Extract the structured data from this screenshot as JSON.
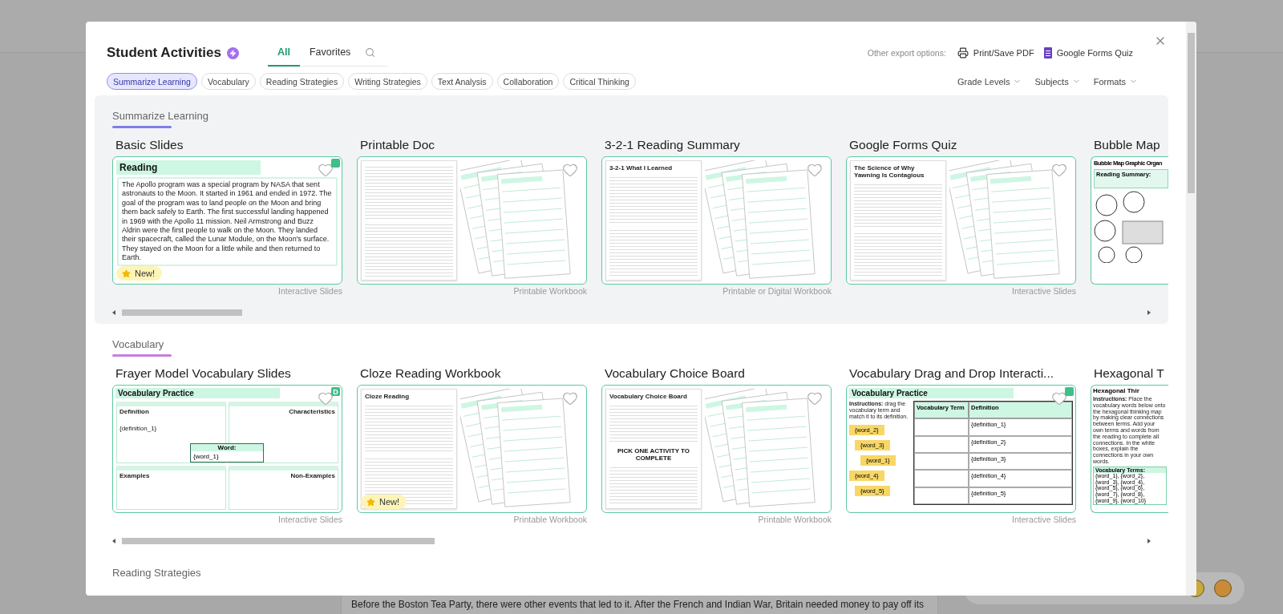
{
  "background": {
    "article_text": "Before the Boston Tea Party, there were other events that led to it. After the French and Indian War, Britain needed money to pay off its"
  },
  "modal": {
    "title": "Student Activities",
    "tabs": [
      {
        "label": "All",
        "selected": true
      },
      {
        "label": "Favorites",
        "selected": false
      }
    ],
    "export": {
      "label": "Other export options:",
      "options": [
        {
          "kind": "printer",
          "label": "Print/Save PDF"
        },
        {
          "kind": "form",
          "label": "Google Forms Quiz"
        }
      ]
    },
    "chips": [
      {
        "label": "Summarize Learning",
        "selected": true
      },
      {
        "label": "Vocabulary",
        "selected": false
      },
      {
        "label": "Reading Strategies",
        "selected": false
      },
      {
        "label": "Writing Strategies",
        "selected": false
      },
      {
        "label": "Text Analysis",
        "selected": false
      },
      {
        "label": "Collaboration",
        "selected": false
      },
      {
        "label": "Critical Thinking",
        "selected": false
      }
    ],
    "filters": [
      "Grade Levels",
      "Subjects",
      "Formats"
    ],
    "sections": [
      {
        "title": "Summarize Learning",
        "color": "#7f7fe6",
        "shaded": true,
        "cards": [
          {
            "title": "Basic Slides",
            "favorite": false,
            "corner": {
              "kind": "slides"
            },
            "badge": "New!",
            "format": "Interactive Slides",
            "thumbnail": {
              "kind": "slide",
              "heading": "Reading",
              "body": "The Apollo program was a special program by NASA that sent astronauts to the Moon. It started in 1961 and ended in 1972. The goal of the program was to land people on the Moon and bring them back safely to Earth. The first successful landing happened in 1969 with the Apollo 11 mission. Neil Armstrong and Buzz Aldrin were the first people to walk on the Moon. They landed their spacecraft, called the Lunar Module, on the Moon's surface. They stayed on the Moon for a little while and then returned to Earth."
            }
          },
          {
            "title": "Printable Doc",
            "favorite": false,
            "format": "Printable Workbook",
            "thumbnail": {
              "kind": "pages"
            }
          },
          {
            "title": "3-2-1 Reading Summary",
            "favorite": false,
            "format": "Printable or Digital Workbook",
            "thumbnail": {
              "kind": "pages",
              "heading": "3-2-1 What I Learned"
            }
          },
          {
            "title": "Google Forms Quiz",
            "favorite": false,
            "format": "Interactive Slides",
            "thumbnail": {
              "kind": "pages",
              "heading": "The Science of Why Yawning Is Contagious"
            }
          },
          {
            "title": "Bubble Map",
            "thumbnail": {
              "kind": "bubble",
              "heading": "Bubble Map Graphic Organ",
              "label": "Reading Summary:"
            }
          }
        ]
      },
      {
        "title": "Vocabulary",
        "color": "#c77ee0",
        "shaded": false,
        "cards": [
          {
            "title": "Frayer Model Vocabulary Slides",
            "favorite": false,
            "corner": {
              "kind": "letter",
              "text": "D"
            },
            "format": "Interactive Slides",
            "thumbnail": {
              "kind": "frayer",
              "heading": "Vocabulary Practice",
              "cells": [
                "Definition",
                "Characteristics",
                "Examples",
                "Non-Examples"
              ],
              "definition": "{definition_1}",
              "word_label": "Word:",
              "word": "{word_1}"
            }
          },
          {
            "title": "Cloze Reading Workbook",
            "favorite": false,
            "badge": "New!",
            "format": "Printable Workbook",
            "thumbnail": {
              "kind": "pages",
              "heading": "Cloze Reading"
            }
          },
          {
            "title": "Vocabulary Choice Board",
            "favorite": false,
            "format": "Printable Workbook",
            "thumbnail": {
              "kind": "pages",
              "heading": "Vocabulary Choice Board",
              "callout": "PICK ONE ACTIVITY TO COMPLETE"
            }
          },
          {
            "title": "Vocabulary Drag and Drop Interacti...",
            "favorite": false,
            "corner": {
              "kind": "slides"
            },
            "format": "Interactive Slides",
            "thumbnail": {
              "kind": "dragdrop",
              "heading": "Vocabulary Practice",
              "instructions": "**Instructions:** drag the vocabulary term and match it to its definition.",
              "columns": [
                "Vocabulary Term",
                "Definition"
              ],
              "words": [
                "{word_2}",
                "{word_3}",
                "{word_1}",
                "{word_4}",
                "{word_5}"
              ],
              "definitions": [
                "{definition_1}",
                "{definition_2}",
                "{definition_3}",
                "{definition_4}",
                "{definition_5}"
              ]
            }
          },
          {
            "title": "Hexagonal T",
            "thumbnail": {
              "kind": "hexagonal",
              "heading": "Hexagonal Thir",
              "instructions": "**Instructions:** Place the vocabulary words below onto the hexagonal thinking map by making clear connections between terms. Add your own terms and words from the reading to complete all connections. In the white boxes, explain the connections in your own words.",
              "list_title": "Vocabulary Terms:",
              "list": "{word_1}, {word_2}, {word_3}, {word_4}, {word_5}, {word_6}, {word_7}, {word_8}, {word_9}, {word_10}"
            }
          }
        ]
      }
    ],
    "next_section": "Reading Strategies"
  }
}
